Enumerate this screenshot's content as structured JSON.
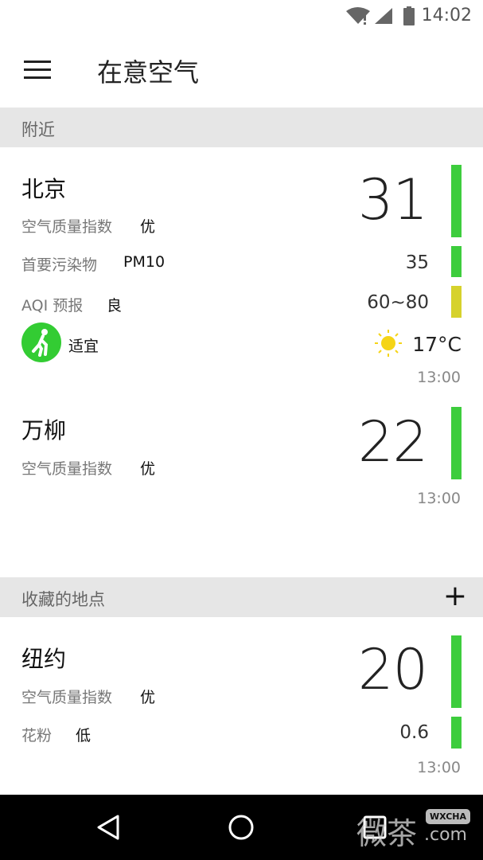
{
  "status_bar": {
    "time": "14:02",
    "icons": [
      "wifi-alert-icon",
      "signal-icon",
      "battery-icon"
    ]
  },
  "toolbar": {
    "title": "在意空气",
    "menu_icon": "hamburger-icon"
  },
  "nearby": {
    "header": "附近",
    "beijing": {
      "city": "北京",
      "aqi_label": "空气质量指数",
      "aqi_level": "优",
      "aqi": "31",
      "pollutant_label": "首要污染物",
      "pollutant": "PM10",
      "pollutant_value": "35",
      "forecast_label": "AQI 预报",
      "forecast_level": "良",
      "forecast_value": "60~80",
      "activity": "适宜",
      "activity_icon": "running-icon",
      "weather_icon": "sun-icon",
      "temperature": "17°C",
      "updated": "13:00"
    },
    "wanliu": {
      "city": "万柳",
      "aqi_label": "空气质量指数",
      "aqi_level": "优",
      "aqi": "22",
      "updated": "13:00"
    }
  },
  "favorites": {
    "header": "收藏的地点",
    "add_icon": "plus-icon",
    "newyork": {
      "city": "纽约",
      "aqi_label": "空气质量指数",
      "aqi_level": "优",
      "aqi": "20",
      "pollen_label": "花粉",
      "pollen_level": "低",
      "pollen_value": "0.6",
      "updated": "13:00"
    }
  },
  "colors": {
    "good": "#3dcd3d",
    "moderate": "#d6d22c",
    "header_bg": "#e6e6e6"
  },
  "nav_bar": {
    "icons": [
      "back-icon",
      "home-icon",
      "recents-icon"
    ]
  },
  "watermark": {
    "text": "微茶",
    "badge": "WXCHA",
    "domain": ".com"
  }
}
